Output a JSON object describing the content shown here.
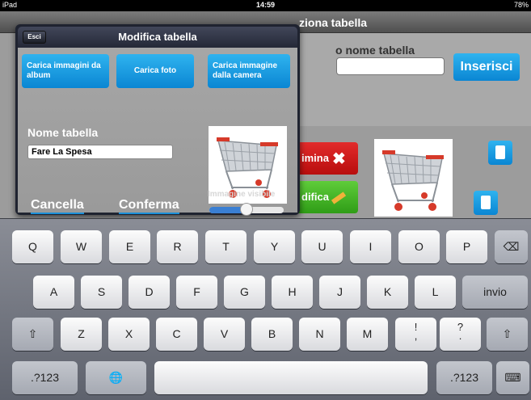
{
  "status_bar": {
    "device": "iPad",
    "wifi_icon": "wifi-icon",
    "time": "14:59",
    "battery": "78%"
  },
  "app": {
    "nav_title": "ziona tabella",
    "name_label": "o nome tabella",
    "insert_label": "Inserisci",
    "delete_label": "imina",
    "edit_label": "difica"
  },
  "popover": {
    "title": "Modifica tabella",
    "exit_label": "Esci",
    "load_album_label": "Carica immagini da album",
    "load_photo_label": "Carica foto",
    "load_camera_label": "Carica immagine dalla camera",
    "table_name_label": "Nome tabella",
    "table_name_value": "Fare La Spesa",
    "cancel_label": "Cancella",
    "confirm_label": "Conferma",
    "visible_label": "Immagine visibile",
    "visible_slider_value": 0.5
  },
  "keyboard": {
    "row1": [
      "Q",
      "W",
      "E",
      "R",
      "T",
      "Y",
      "U",
      "I",
      "O",
      "P"
    ],
    "row2": [
      "A",
      "S",
      "D",
      "F",
      "G",
      "H",
      "J",
      "K",
      "L"
    ],
    "row3": [
      "Z",
      "X",
      "C",
      "V",
      "B",
      "N",
      "M"
    ],
    "return_label": "invio",
    "numbers_label": ".?123",
    "punct1_top": "!",
    "punct1_bottom": ",",
    "punct2_top": "?",
    "punct2_bottom": "."
  }
}
